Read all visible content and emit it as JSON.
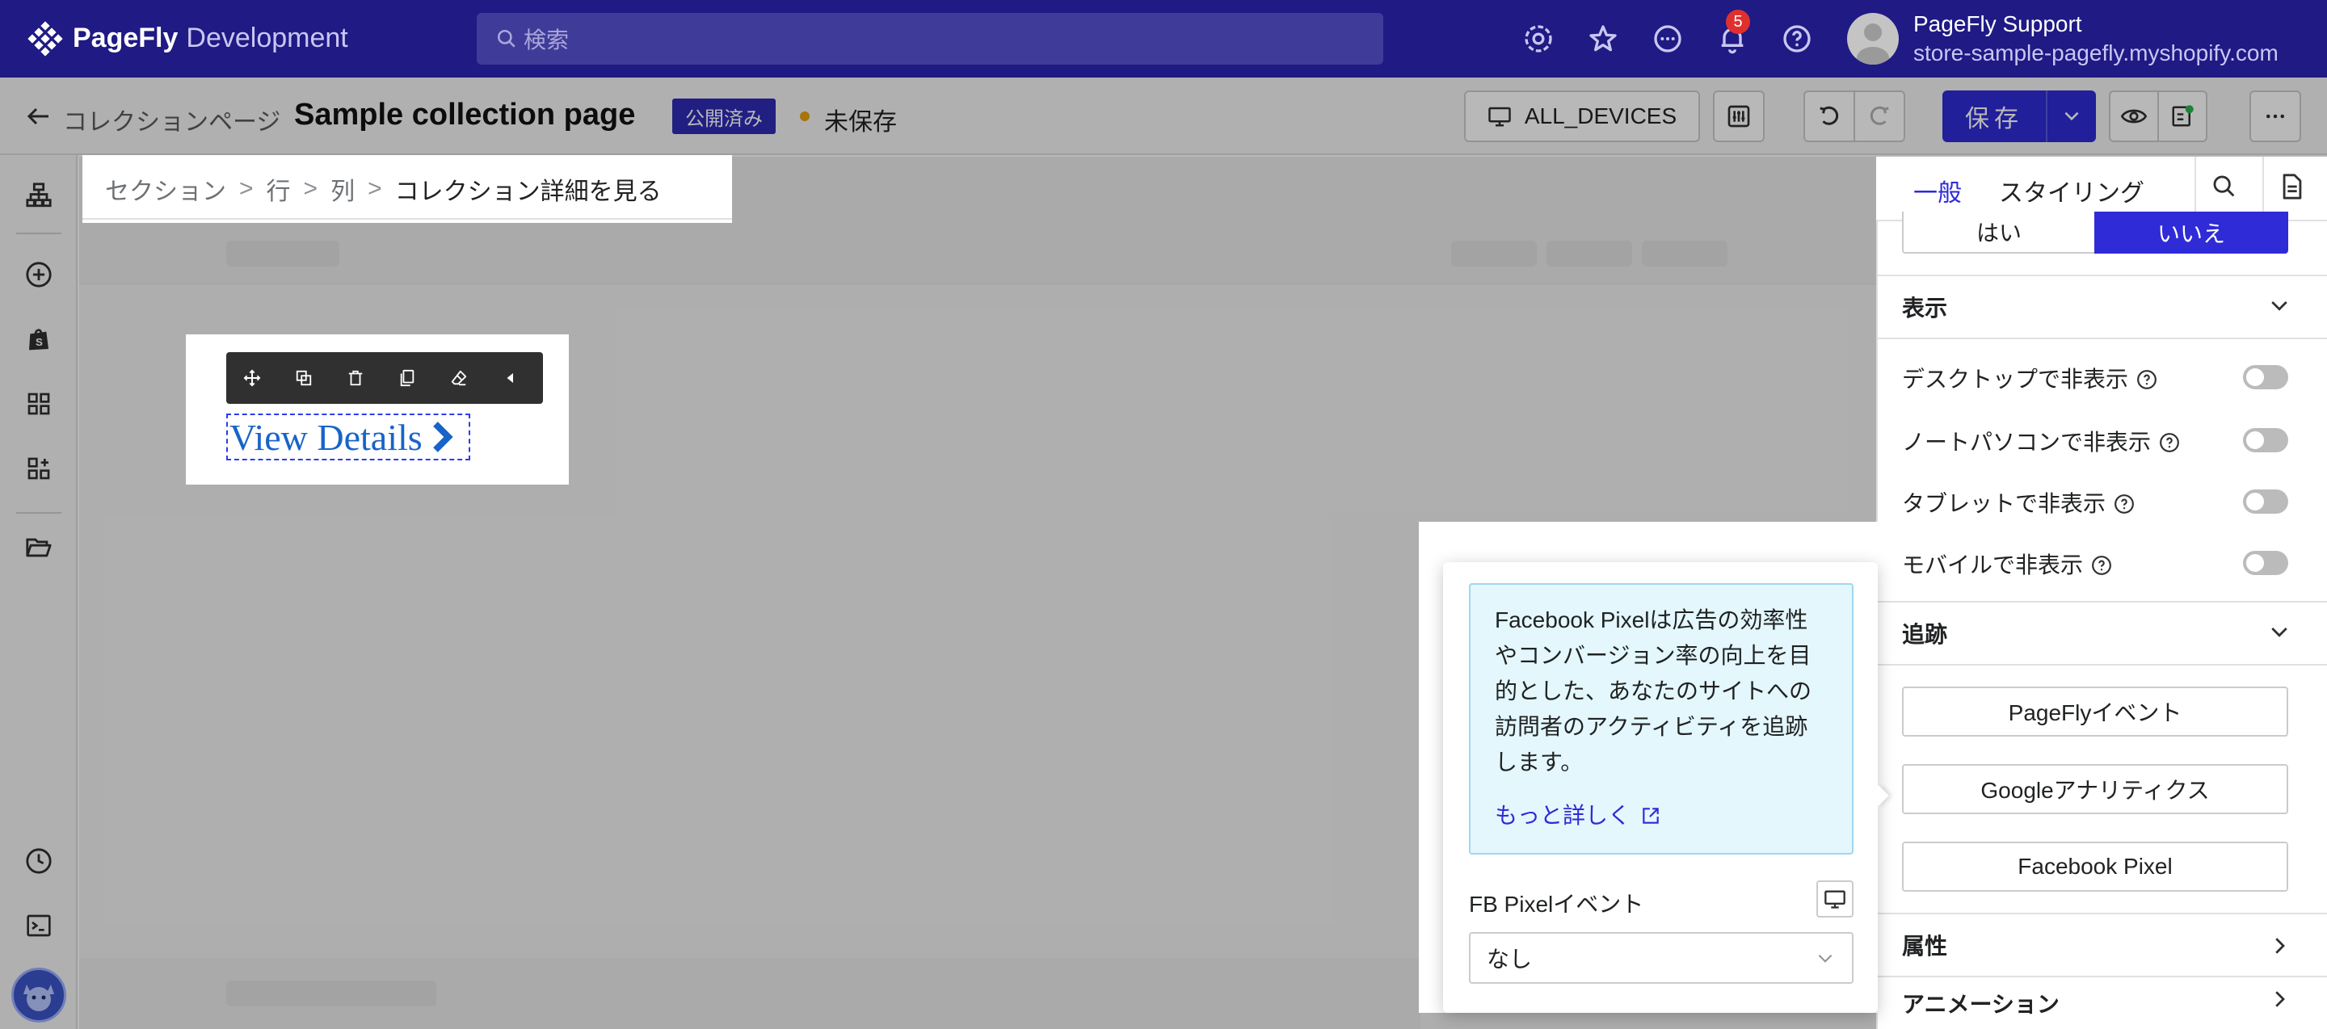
{
  "app": {
    "logo_brand": "PageFly",
    "logo_env": "Development",
    "search_placeholder": "検索",
    "notification_count": "5",
    "user_name": "PageFly Support",
    "user_store": "store-sample-pagefly.myshopify.com",
    "colors": {
      "topbar": "#1f1a84",
      "accent": "#2f2bd6",
      "badge": "#e0302e",
      "unsaved": "#e6a10c"
    },
    "top_icons": [
      "settings-icon",
      "star-icon",
      "chat-icon",
      "bell-icon",
      "help-icon"
    ]
  },
  "header": {
    "back_label": "コレクションページ",
    "title": "Sample collection page",
    "status_badge": "公開済み",
    "unsaved_label": "未保存",
    "devices_label": "ALL_DEVICES",
    "save_label": "保存"
  },
  "breadcrumb": {
    "items": [
      "セクション",
      "行",
      "列"
    ],
    "separator": ">",
    "current": "コレクション詳細を見る"
  },
  "element": {
    "label": "View Details",
    "toolbar_icons": [
      "move-icon",
      "duplicate-icon",
      "delete-icon",
      "copy-icon",
      "eraser-icon",
      "collapse-icon"
    ]
  },
  "panel": {
    "tabs": {
      "general": "一般",
      "styling": "スタイリング"
    },
    "yes_label": "はい",
    "no_label": "いいえ",
    "display": {
      "title": "表示",
      "toggles": [
        {
          "label": "デスクトップで非表示",
          "on": false
        },
        {
          "label": "ノートパソコンで非表示",
          "on": false
        },
        {
          "label": "タブレットで非表示",
          "on": false
        },
        {
          "label": "モバイルで非表示",
          "on": false
        }
      ]
    },
    "tracking": {
      "title": "追跡",
      "buttons": [
        "PageFlyイベント",
        "Googleアナリティクス",
        "Facebook Pixel"
      ]
    },
    "attributes_title": "属性",
    "animation_title": "アニメーション"
  },
  "popover": {
    "info_lines": [
      "Facebook Pixelは広告の効率性",
      "やコンバージョン率の向上を目",
      "的とした、あなたのサイトへの",
      "訪問者のアクティビティを追跡",
      "します。"
    ],
    "learn_more": "もっと詳しく",
    "event_label": "FB Pixelイベント",
    "event_value": "なし"
  }
}
